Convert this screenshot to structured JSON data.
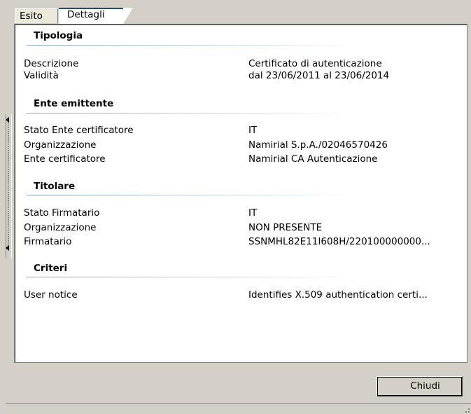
{
  "tabs": [
    {
      "label": "Esito",
      "active": false
    },
    {
      "label": "Dettagli",
      "active": true
    }
  ],
  "sections": [
    {
      "title": "Tipologia",
      "rows": [
        {
          "label": "Descrizione",
          "value": "Certificato di autenticazione"
        },
        {
          "label": "Validità",
          "value": "dal 23/06/2011 al 23/06/2014"
        }
      ]
    },
    {
      "title": "Ente emittente",
      "rows": [
        {
          "label": "Stato Ente certificatore",
          "value": "IT"
        },
        {
          "label": "Organizzazione",
          "value": "Namirial S.p.A./02046570426"
        },
        {
          "label": "Ente certificatore",
          "value": "Namirial CA Autenticazione"
        }
      ]
    },
    {
      "title": "Titolare",
      "rows": [
        {
          "label": "Stato Firmatario",
          "value": "IT"
        },
        {
          "label": "Organizzazione",
          "value": "NON PRESENTE"
        },
        {
          "label": "Firmatario",
          "value": "SSNMHL82E11I608H/220100000000..."
        }
      ]
    },
    {
      "title": "Criteri",
      "rows": [
        {
          "label": "User notice",
          "value": "Identifies X.509 authentication certi..."
        }
      ]
    }
  ],
  "buttons": {
    "close_label": "Chiudi"
  },
  "colors": {
    "window_bg": "#d4d0c8",
    "panel_bg": "#ffffff",
    "section_line": "#7fa3cc"
  }
}
